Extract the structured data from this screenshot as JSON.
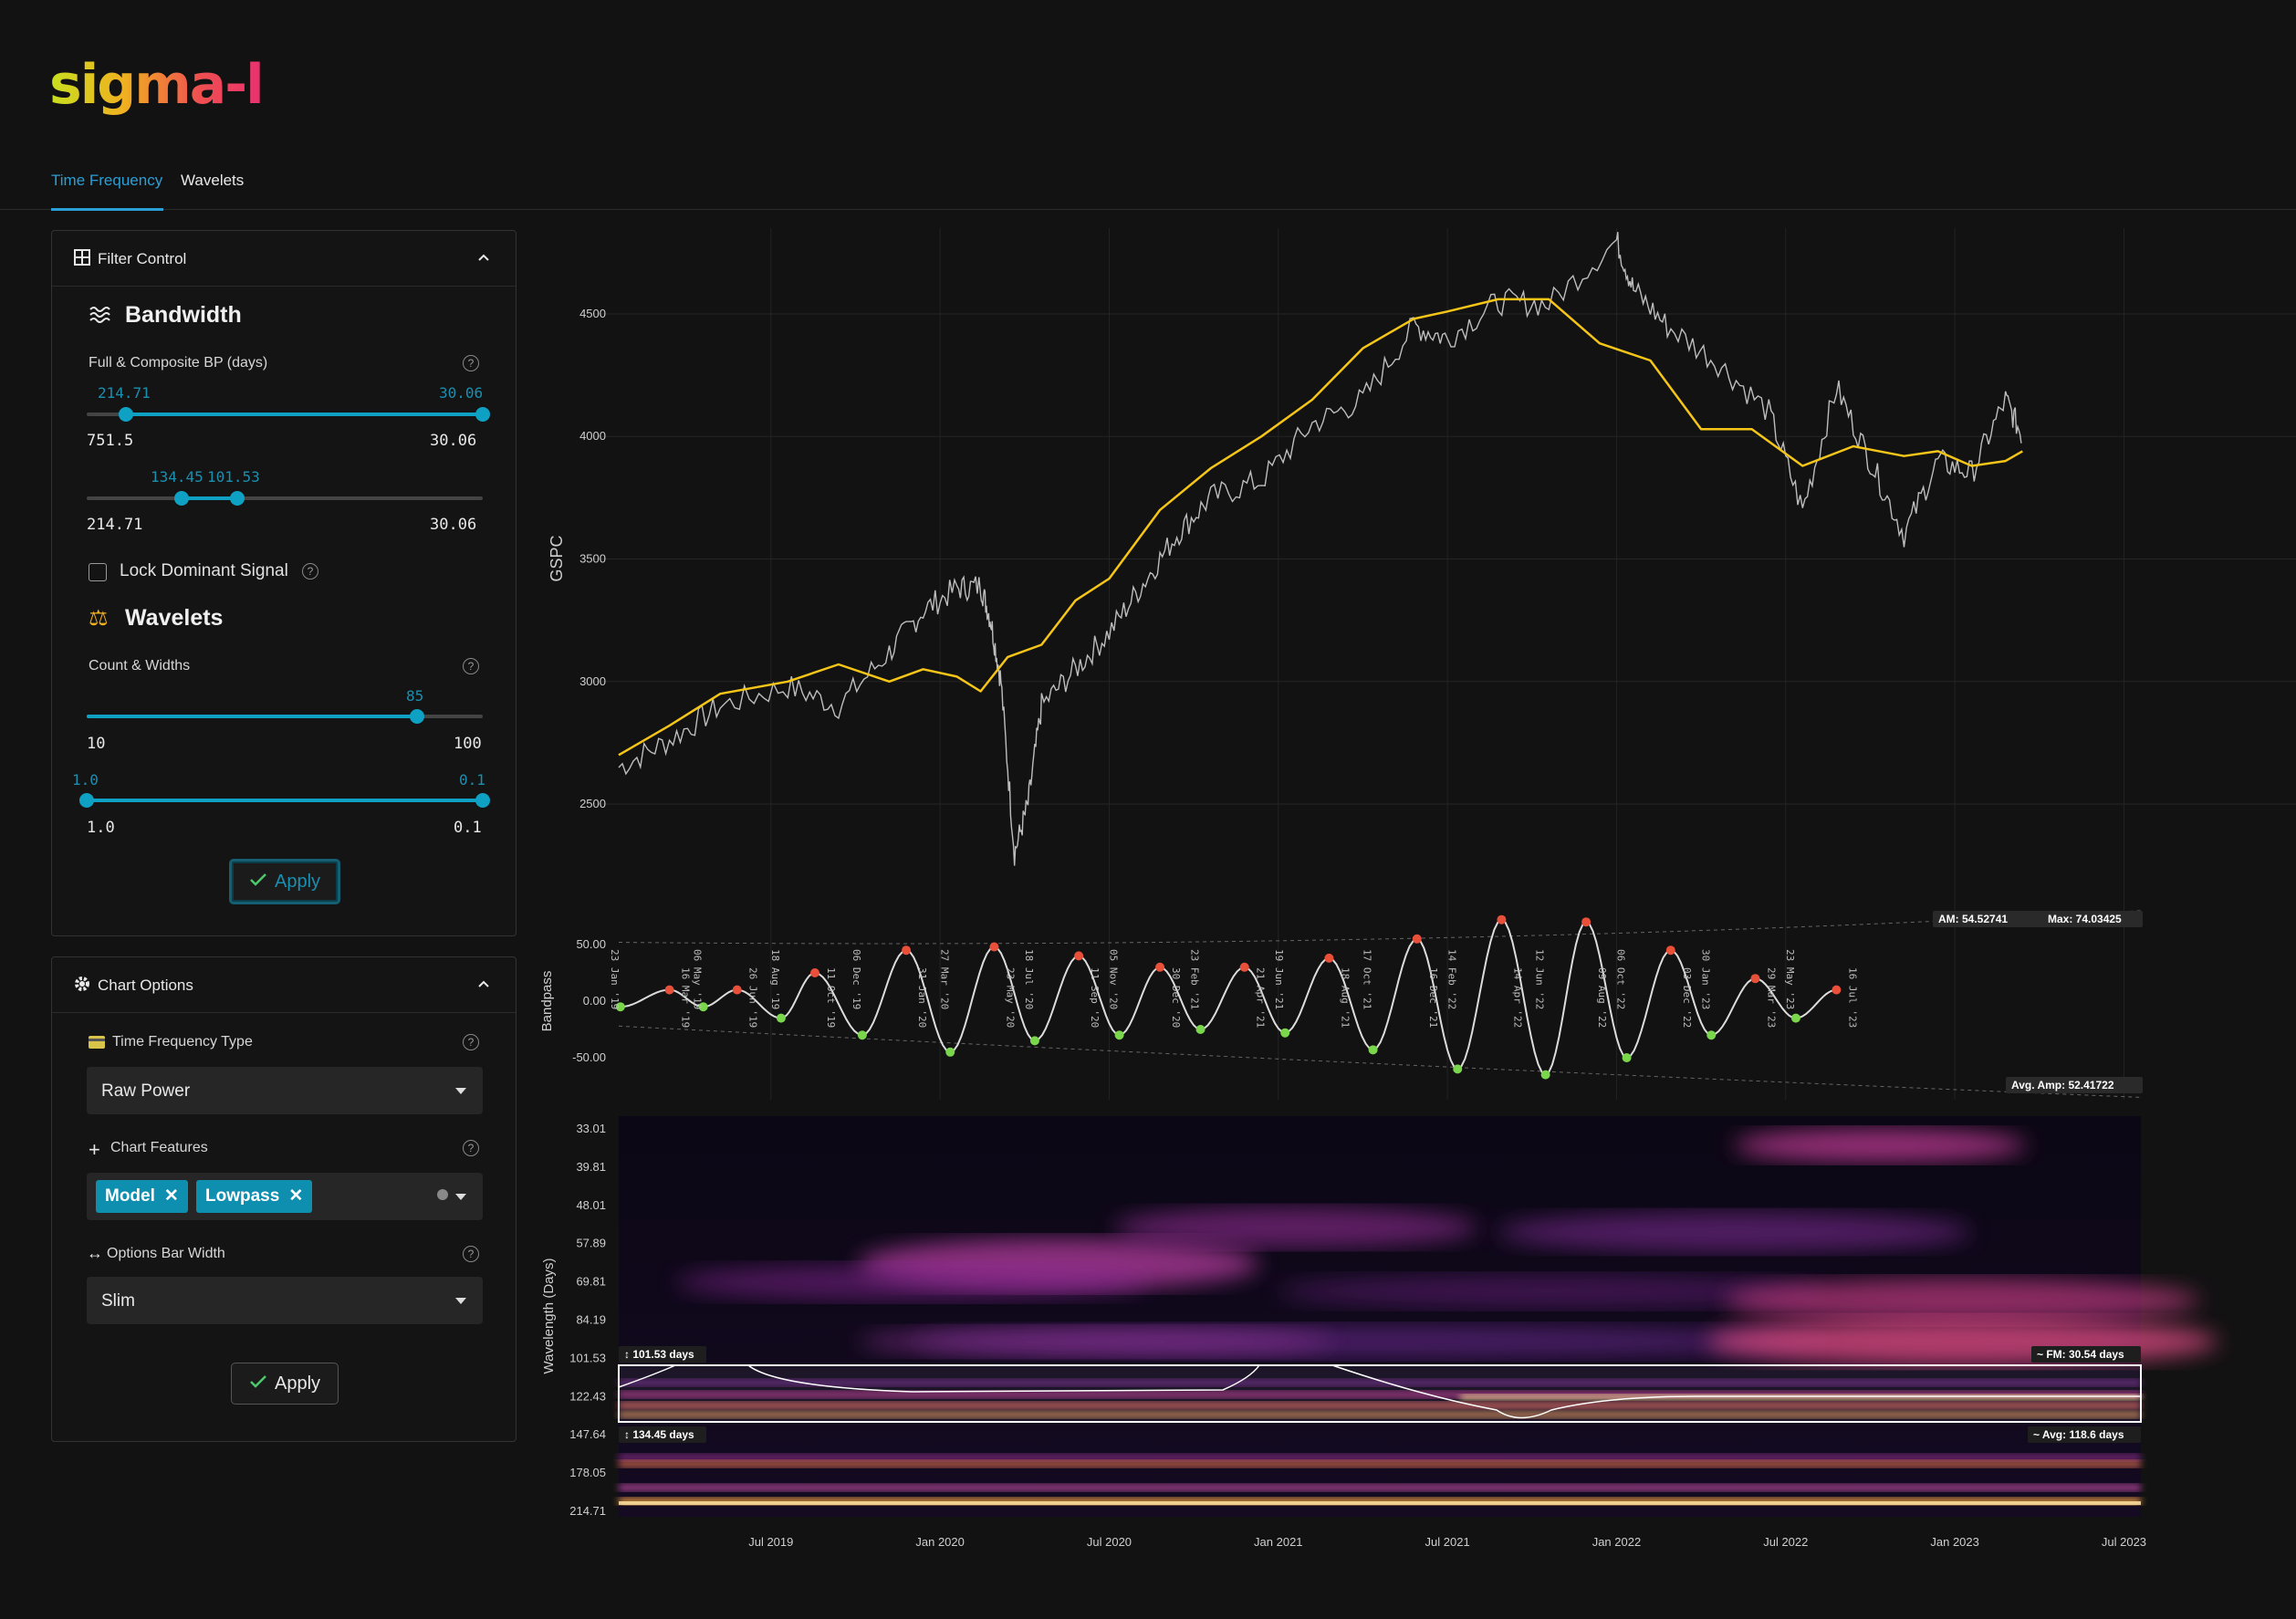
{
  "app": {
    "logo": "sigma-l"
  },
  "tabs": [
    {
      "label": "Time Frequency",
      "active": true
    },
    {
      "label": "Wavelets",
      "active": false
    }
  ],
  "filter_control": {
    "title": "Filter Control",
    "bandwidth": {
      "title": "Bandwidth",
      "label": "Full & Composite BP (days)",
      "slider1": {
        "min_label": "751.5",
        "max_label": "30.06",
        "low_value": "214.71",
        "high_value": "30.06",
        "low_frac": 0.1,
        "high_frac": 1.0
      },
      "slider2": {
        "min_label": "214.71",
        "max_label": "30.06",
        "low_value": "134.45",
        "high_value": "101.53",
        "low_frac": 0.24,
        "high_frac": 0.38
      },
      "lock_label": "Lock Dominant Signal",
      "lock_checked": false
    },
    "wavelets": {
      "title": "Wavelets",
      "label": "Count & Widths",
      "count": {
        "min_label": "10",
        "max_label": "100",
        "value": "85",
        "frac": 0.833
      },
      "widths": {
        "min_label": "1.0",
        "max_label": "0.1",
        "low_value": "1.0",
        "high_value": "0.1",
        "low_frac": 0.0,
        "high_frac": 1.0
      }
    },
    "apply_label": "Apply"
  },
  "chart_options": {
    "title": "Chart Options",
    "tf_type_label": "Time Frequency Type",
    "tf_type_value": "Raw Power",
    "features_label": "Chart Features",
    "features": [
      "Model",
      "Lowpass"
    ],
    "bar_width_label": "Options Bar Width",
    "bar_width_value": "Slim",
    "apply_label": "Apply"
  },
  "colors": {
    "accent": "#0fa1c4",
    "price": "#bdbdbd",
    "lowpass": "#f5c518",
    "peak": "#e8503a",
    "trough": "#7ad64a",
    "background": "#121212"
  },
  "chart_data": [
    {
      "type": "line",
      "ylabel": "GSPC",
      "y_ticks": [
        "2500",
        "3000",
        "3500",
        "4000",
        "4500"
      ],
      "ylim": [
        2150,
        4850
      ],
      "x_ticks": [
        "Jul 2019",
        "Jan 2020",
        "Jul 2020",
        "Jan 2021",
        "Jul 2021",
        "Jan 2022",
        "Jul 2022",
        "Jan 2023",
        "Jul 2023"
      ],
      "x_tick_t": [
        0.5,
        1.0,
        1.5,
        2.0,
        2.5,
        3.0,
        3.5,
        4.0,
        4.5
      ],
      "xlim": [
        0.05,
        4.55
      ],
      "series": [
        {
          "t": [
            0.05,
            0.2,
            0.35,
            0.55,
            0.7,
            0.85,
            0.95,
            1.05,
            1.12,
            1.15,
            1.18,
            1.22,
            1.26,
            1.3,
            1.4,
            1.5,
            1.6,
            1.7,
            1.8,
            1.95,
            2.1,
            2.25,
            2.4,
            2.5,
            2.65,
            2.8,
            3.0,
            3.05,
            3.15,
            3.3,
            3.45,
            3.55,
            3.65,
            3.75,
            3.85,
            3.95,
            4.05,
            4.15,
            4.2
          ],
          "values": [
            2650,
            2760,
            2900,
            2980,
            2900,
            3120,
            3290,
            3380,
            3390,
            3250,
            3000,
            2300,
            2500,
            2900,
            3050,
            3200,
            3400,
            3600,
            3750,
            3820,
            4050,
            4150,
            4450,
            4400,
            4550,
            4540,
            4800,
            4600,
            4450,
            4300,
            4100,
            3700,
            4200,
            3900,
            3600,
            3900,
            3850,
            4150,
            4000
          ]
        },
        {
          "t": [
            0.05,
            0.2,
            0.35,
            0.55,
            0.7,
            0.85,
            0.95,
            1.05,
            1.12,
            1.2,
            1.3,
            1.4,
            1.5,
            1.65,
            1.8,
            1.95,
            2.1,
            2.25,
            2.4,
            2.5,
            2.65,
            2.8,
            2.95,
            3.1,
            3.25,
            3.4,
            3.55,
            3.7,
            3.85,
            3.95,
            4.05,
            4.15,
            4.2
          ],
          "values": [
            2700,
            2820,
            2950,
            3000,
            3070,
            3000,
            3050,
            3020,
            2960,
            3100,
            3150,
            3330,
            3420,
            3700,
            3870,
            4000,
            4150,
            4360,
            4480,
            4510,
            4560,
            4560,
            4380,
            4310,
            4030,
            4030,
            3880,
            3960,
            3920,
            3940,
            3880,
            3900,
            3940
          ]
        }
      ]
    },
    {
      "type": "line",
      "ylabel": "Bandpass",
      "y_ticks": [
        "50.00",
        "0.00",
        "-50.00"
      ],
      "ylim": [
        -60,
        60
      ],
      "annotations": {
        "am": "AM: 54.52741",
        "max": "Max: 74.03425",
        "avg_amp": "Avg. Amp: 52.41722"
      },
      "cycle_labels": [
        "23 Jan '19",
        "16 Mar '19",
        "06 May '19",
        "26 Jun '19",
        "18 Aug '19",
        "11 Oct '19",
        "06 Dec '19",
        "31 Jan '20",
        "27 Mar '20",
        "23 May '20",
        "18 Jul '20",
        "11 Sep '20",
        "05 Nov '20",
        "30 Dec '20",
        "23 Feb '21",
        "21 Apr '21",
        "19 Jun '21",
        "18 Aug '21",
        "17 Oct '21",
        "16 Dec '21",
        "14 Feb '22",
        "14 Apr '22",
        "12 Jun '22",
        "09 Aug '22",
        "06 Oct '22",
        "03 Dec '22",
        "30 Jan '23",
        "29 Mar '23",
        "23 May '23",
        "16 Jul '23"
      ],
      "cycle_t": [
        0.055,
        0.2,
        0.3,
        0.4,
        0.53,
        0.63,
        0.77,
        0.9,
        1.03,
        1.16,
        1.28,
        1.41,
        1.53,
        1.65,
        1.77,
        1.9,
        2.02,
        2.15,
        2.28,
        2.41,
        2.53,
        2.66,
        2.79,
        2.91,
        3.03,
        3.16,
        3.28,
        3.41,
        3.53,
        3.65
      ],
      "cycle_values": [
        -5,
        10,
        -5,
        10,
        -15,
        25,
        -30,
        45,
        -45,
        48,
        -35,
        40,
        -30,
        30,
        -25,
        30,
        -28,
        38,
        -43,
        55,
        -60,
        72,
        -65,
        70,
        -50,
        45,
        -30,
        20,
        -15,
        10
      ]
    },
    {
      "type": "heatmap",
      "ylabel": "Wavelength (Days)",
      "y_ticks": [
        "33.01",
        "39.81",
        "48.01",
        "57.89",
        "69.81",
        "84.19",
        "101.53",
        "122.43",
        "147.64",
        "178.05",
        "214.71"
      ],
      "band_labels": {
        "upper": "101.53 days",
        "lower": "134.45 days",
        "fm": "FM: 30.54 days",
        "avg": "Avg: 118.6 days"
      }
    }
  ]
}
